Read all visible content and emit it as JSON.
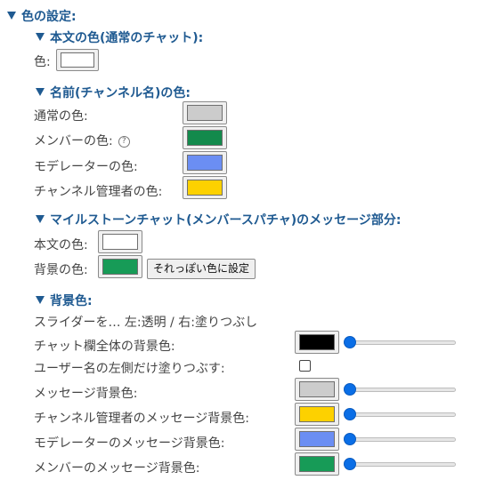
{
  "color_settings": {
    "heading": "色の設定:",
    "body_text": {
      "heading": "本文の色(通常のチャット):",
      "color_label": "色:",
      "color": "#ffffff"
    },
    "name": {
      "heading": "名前(チャンネル名)の色:",
      "rows": [
        {
          "label": "通常の色:",
          "color": "#cccccc",
          "help": false
        },
        {
          "label": "メンバーの色:",
          "color": "#138a4c",
          "help": true,
          "help_glyph": "?"
        },
        {
          "label": "モデレーターの色:",
          "color": "#6b8ef3",
          "help": false
        },
        {
          "label": "チャンネル管理者の色:",
          "color": "#fdd100",
          "help": false
        }
      ]
    },
    "milestone": {
      "heading": "マイルストーンチャット(メンバースパチャ)のメッセージ部分:",
      "body_label": "本文の色:",
      "body_color": "#ffffff",
      "bg_label": "背景の色:",
      "bg_color": "#179b57",
      "set_similar_button": "それっぽい色に設定"
    },
    "background": {
      "heading": "背景色:",
      "note": "スライダーを… 左:透明 / 右:塗りつぶし",
      "chat_bg": {
        "label": "チャット欄全体の背景色:",
        "color": "#000000",
        "slider_value": 0
      },
      "username_left_label": "ユーザー名の左側だけ塗りつぶす:",
      "username_left_checked": false,
      "rows": [
        {
          "label": "メッセージ背景色:",
          "color": "#cccccc",
          "slider_value": 0
        },
        {
          "label": "チャンネル管理者のメッセージ背景色:",
          "color": "#fdd100",
          "slider_value": 0
        },
        {
          "label": "モデレーターのメッセージ背景色:",
          "color": "#6b8ef3",
          "slider_value": 0
        },
        {
          "label": "メンバーのメッセージ背景色:",
          "color": "#179b57",
          "slider_value": 0
        }
      ]
    }
  },
  "colors": {
    "heading": "#1f5a91",
    "slider_thumb": "#0a6ee6"
  }
}
